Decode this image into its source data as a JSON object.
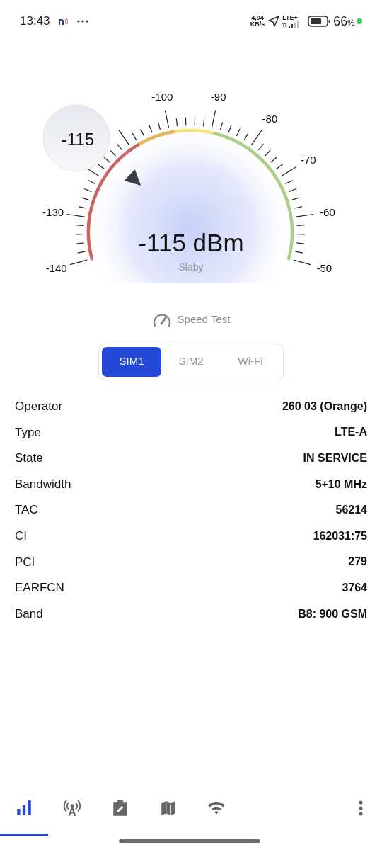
{
  "status_bar": {
    "time": "13:43",
    "speed": "4,94",
    "speed_unit": "KB/s",
    "network": "LTE+",
    "battery": "66",
    "battery_unit": "%"
  },
  "gauge": {
    "scale_labels": [
      "-140",
      "-130",
      "-100",
      "-90",
      "-80",
      "-70",
      "-60",
      "-50"
    ],
    "zones": [
      {
        "color": "#c96560"
      },
      {
        "color": "#eab45a"
      },
      {
        "color": "#f3e27a"
      },
      {
        "color": "#a9cf84"
      }
    ],
    "bubble": "-115",
    "reading": "-115 dBm",
    "quality": "Słaby"
  },
  "speed_test": {
    "label": "Speed Test"
  },
  "tabs": [
    {
      "label": "SIM1",
      "selected": true
    },
    {
      "label": "SIM2",
      "selected": false
    },
    {
      "label": "Wi-Fi",
      "selected": false
    }
  ],
  "rows": [
    {
      "label": "Operator",
      "value": "260 03 (Orange)"
    },
    {
      "label": "Type",
      "value": "LTE-A"
    },
    {
      "label": "State",
      "value": "IN SERVICE"
    },
    {
      "label": "Bandwidth",
      "value": "5+10 MHz"
    },
    {
      "label": "TAC",
      "value": "56214"
    },
    {
      "label": "CI",
      "value": "162031:75"
    },
    {
      "label": "PCI",
      "value": "279"
    },
    {
      "label": "EARFCN",
      "value": "3764"
    },
    {
      "label": "Band",
      "value": "B8: 900 GSM"
    }
  ],
  "nav": [
    {
      "kind": "signal",
      "selected": true
    },
    {
      "kind": "tower",
      "selected": false
    },
    {
      "kind": "clipboard",
      "selected": false
    },
    {
      "kind": "map",
      "selected": false
    },
    {
      "kind": "wifi",
      "selected": false
    }
  ]
}
